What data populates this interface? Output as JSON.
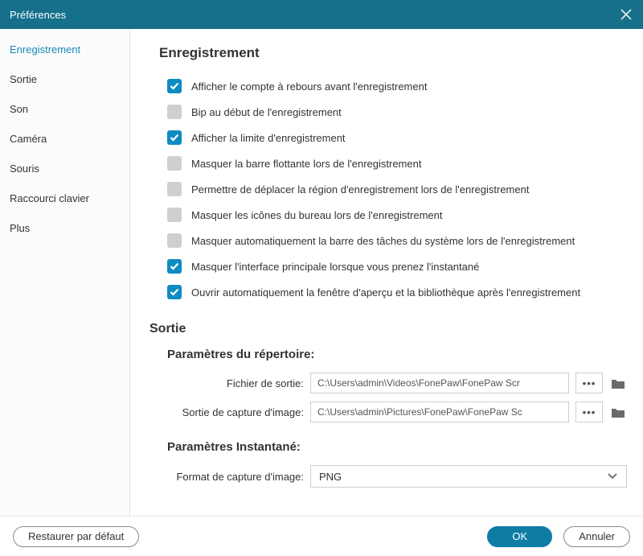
{
  "window": {
    "title": "Préférences"
  },
  "sidebar": {
    "items": [
      {
        "label": "Enregistrement",
        "active": true
      },
      {
        "label": "Sortie"
      },
      {
        "label": "Son"
      },
      {
        "label": "Caméra"
      },
      {
        "label": "Souris"
      },
      {
        "label": "Raccourci clavier"
      },
      {
        "label": "Plus"
      }
    ]
  },
  "section_recording": {
    "heading": "Enregistrement",
    "options": [
      {
        "label": "Afficher le compte à rebours avant l'enregistrement",
        "checked": true
      },
      {
        "label": "Bip au début de l'enregistrement",
        "checked": false
      },
      {
        "label": "Afficher la limite d'enregistrement",
        "checked": true
      },
      {
        "label": "Masquer la barre flottante lors de l'enregistrement",
        "checked": false
      },
      {
        "label": "Permettre de déplacer la région d'enregistrement lors de l'enregistrement",
        "checked": false
      },
      {
        "label": "Masquer les icônes du bureau lors de l'enregistrement",
        "checked": false
      },
      {
        "label": "Masquer automatiquement la barre des tâches du système lors de l'enregistrement",
        "checked": false
      },
      {
        "label": "Masquer l'interface principale lorsque vous prenez l'instantané",
        "checked": true
      },
      {
        "label": "Ouvrir automatiquement la fenêtre d'aperçu et la bibliothèque après l'enregistrement",
        "checked": true
      }
    ]
  },
  "section_output": {
    "heading": "Sortie",
    "dir_heading": "Paramètres du répertoire:",
    "dirs": [
      {
        "label": "Fichier de sortie:",
        "value": "C:\\Users\\admin\\Videos\\FonePaw\\FonePaw Scr"
      },
      {
        "label": "Sortie de capture d'image:",
        "value": "C:\\Users\\admin\\Pictures\\FonePaw\\FonePaw Sc"
      }
    ],
    "snapshot_heading": "Paramètres Instantané:",
    "format_label": "Format de capture d'image:",
    "format_value": "PNG"
  },
  "footer": {
    "restore": "Restaurer par défaut",
    "ok": "OK",
    "cancel": "Annuler"
  },
  "glyphs": {
    "dots": "•••"
  }
}
